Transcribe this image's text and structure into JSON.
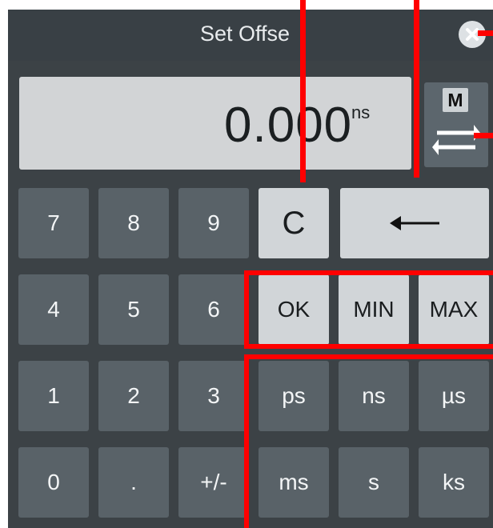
{
  "dialog": {
    "title": "Set Offse",
    "close_icon": "close-icon",
    "close_symbol": "×"
  },
  "display": {
    "value": "0.000",
    "unit": "ns"
  },
  "memory_button": {
    "label": "M",
    "icon": "swap-arrows-icon"
  },
  "keypad": {
    "digits": [
      "7",
      "8",
      "9",
      "4",
      "5",
      "6",
      "1",
      "2",
      "3",
      "0",
      ".",
      "+/-"
    ],
    "clear": "C",
    "backspace_icon": "backspace-arrow-icon"
  },
  "actions": [
    "OK",
    "MIN",
    "MAX"
  ],
  "units": [
    "ps",
    "ns",
    "µs",
    "ms",
    "s",
    "ks"
  ],
  "colors": {
    "panel": "#3c4246",
    "dark_key": "#596268",
    "light_key": "#d1d5d8",
    "display": "#d2d4d6",
    "callout": "#ff0000"
  }
}
